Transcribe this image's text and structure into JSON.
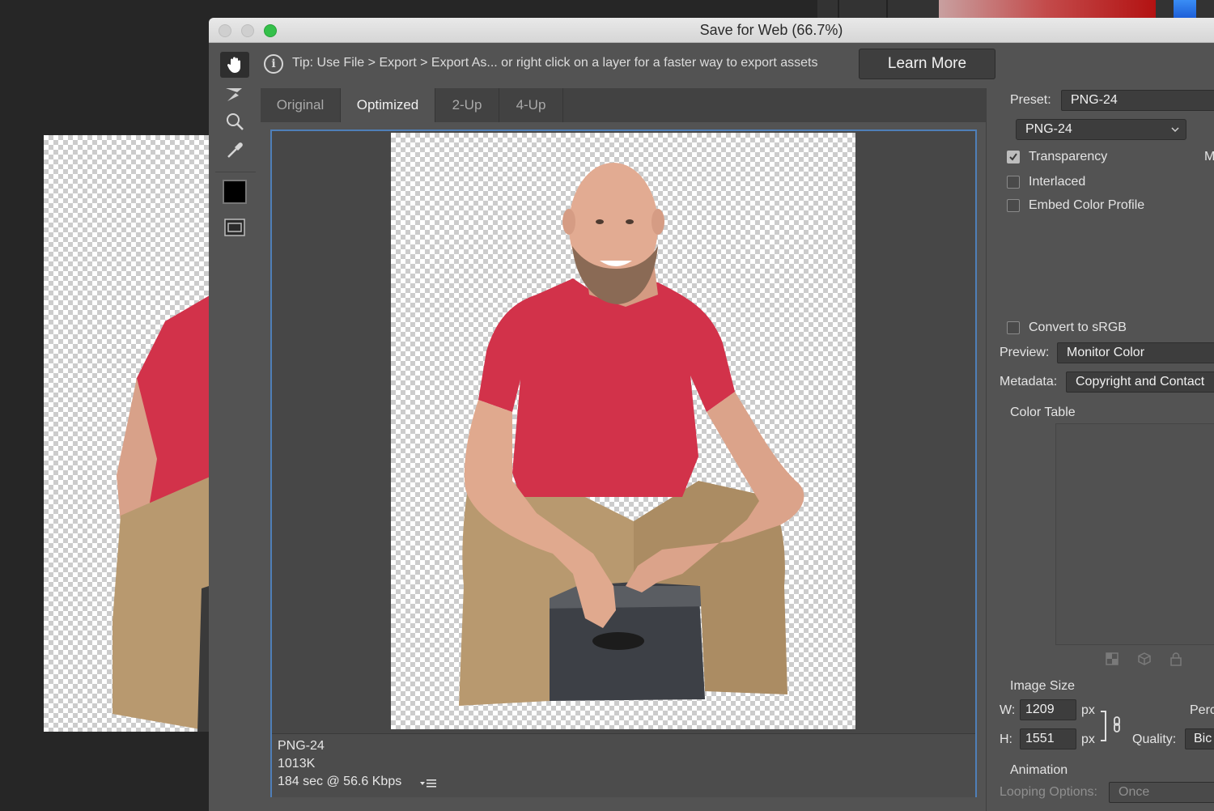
{
  "window": {
    "title": "Save for Web (66.7%)"
  },
  "icons": {
    "hand": "hand-tool-icon",
    "slice_select": "slice-select-tool-icon",
    "zoom": "zoom-tool-icon",
    "eyedropper": "eyedropper-tool-icon",
    "color_swatch": "eyedropper-color-swatch",
    "toggle_slices": "toggle-slices-icon",
    "info": "info-icon"
  },
  "tip": {
    "icon_glyph": "i",
    "text": "Tip: Use File > Export > Export As...  or right click on a layer for a faster way to export assets",
    "learn_more": "Learn More"
  },
  "tabs": [
    "Original",
    "Optimized",
    "2-Up",
    "4-Up"
  ],
  "active_tab": "Optimized",
  "status": {
    "format": "PNG-24",
    "size": "1013K",
    "download_time": "184 sec @ 56.6 Kbps"
  },
  "settings": {
    "preset_label": "Preset:",
    "preset_value": "PNG-24",
    "format_value": "PNG-24",
    "transparency_label": "Transparency",
    "transparency_checked": true,
    "interlaced_label": "Interlaced",
    "interlaced_checked": false,
    "embed_label": "Embed Color Profile",
    "embed_checked": false,
    "clipped_right_text": "M",
    "convert_label": "Convert to sRGB",
    "convert_checked": false,
    "preview_label": "Preview:",
    "preview_value": "Monitor Color",
    "metadata_label": "Metadata:",
    "metadata_value": "Copyright and Contact",
    "color_table_label": "Color Table",
    "image_size_label": "Image Size",
    "w_label": "W:",
    "w_value": "1209",
    "h_label": "H:",
    "h_value": "1551",
    "px": "px",
    "percent_label": "Perc",
    "quality_label": "Quality:",
    "quality_value": "Bic",
    "animation_label": "Animation",
    "looping_label": "Looping Options:",
    "looping_value": "Once"
  },
  "colors": {
    "accent_frame": "#4f7fb8",
    "shirt": "#d2324a",
    "pants": "#b8996f",
    "skin": "#e0a98e",
    "panel_bg": "#535353"
  }
}
